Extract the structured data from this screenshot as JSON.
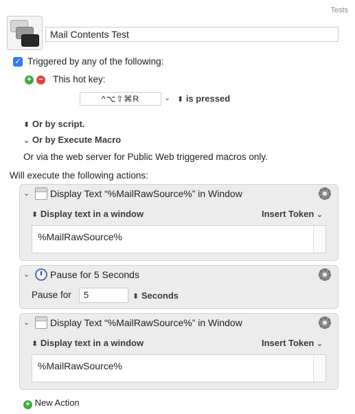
{
  "header": {
    "group_name": "Tests"
  },
  "macro": {
    "name": "Mail Contents Test"
  },
  "trigger": {
    "checkbox_label": "Triggered by any of the following:",
    "checkbox_checked": true,
    "hotkey_label": "This hot key:",
    "hotkey_value": "^⌥⇧⌘R",
    "hotkey_condition": "is pressed",
    "or_script": "Or by script.",
    "or_execute_macro": "Or by Execute Macro",
    "web_server_text": "Or via the web server for Public Web triggered macros only."
  },
  "actions_header": "Will execute the following actions:",
  "actions": [
    {
      "title": "Display Text “%MailRawSource%” in Window",
      "mode": "Display text in a window",
      "insert_token": "Insert Token",
      "text": "%MailRawSource%"
    },
    {
      "title": "Pause for 5 Seconds",
      "pause_label": "Pause for",
      "pause_value": "5",
      "unit": "Seconds"
    },
    {
      "title": "Display Text “%MailRawSource%” in Window",
      "mode": "Display text in a window",
      "insert_token": "Insert Token",
      "text": "%MailRawSource%"
    }
  ],
  "footer": {
    "new_action": "New Action"
  },
  "icons": {
    "disclosure": "chevron-down-icon",
    "stepper": "up-down-chevron-icon",
    "gear": "gear-icon",
    "window": "window-icon",
    "clock": "clock-icon"
  }
}
